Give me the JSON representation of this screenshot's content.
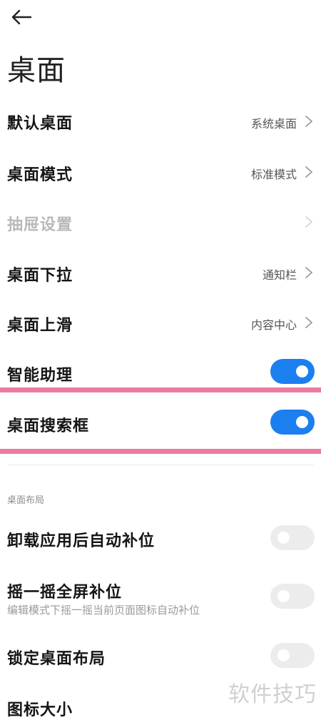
{
  "header": {
    "title": "桌面"
  },
  "rows": {
    "default_desktop": {
      "label": "默认桌面",
      "value": "系统桌面"
    },
    "desktop_mode": {
      "label": "桌面模式",
      "value": "标准模式"
    },
    "drawer_settings": {
      "label": "抽屉设置"
    },
    "swipe_down": {
      "label": "桌面下拉",
      "value": "通知栏"
    },
    "swipe_up": {
      "label": "桌面上滑",
      "value": "内容中心"
    },
    "smart_assistant": {
      "label": "智能助理",
      "enabled": true
    },
    "search_box": {
      "label": "桌面搜索框",
      "enabled": true
    }
  },
  "layout_section": {
    "header": "桌面布局",
    "auto_fill": {
      "label": "卸载应用后自动补位",
      "enabled": false
    },
    "shake_fill": {
      "label": "摇一摇全屏补位",
      "subtitle": "编辑模式下摇一摇当前页面图标自动补位",
      "enabled": false
    },
    "lock_layout": {
      "label": "锁定桌面布局",
      "enabled": false
    },
    "icon_size": {
      "label": "图标大小"
    }
  },
  "watermark": "软件技巧",
  "colors": {
    "toggle_on": "#1b7ff0",
    "toggle_off": "#ececec",
    "highlight": "#ea7c9d",
    "disabled_text": "#b9b9b9"
  },
  "icons": {
    "back": "back-arrow-icon",
    "chevron": "chevron-right-icon"
  }
}
